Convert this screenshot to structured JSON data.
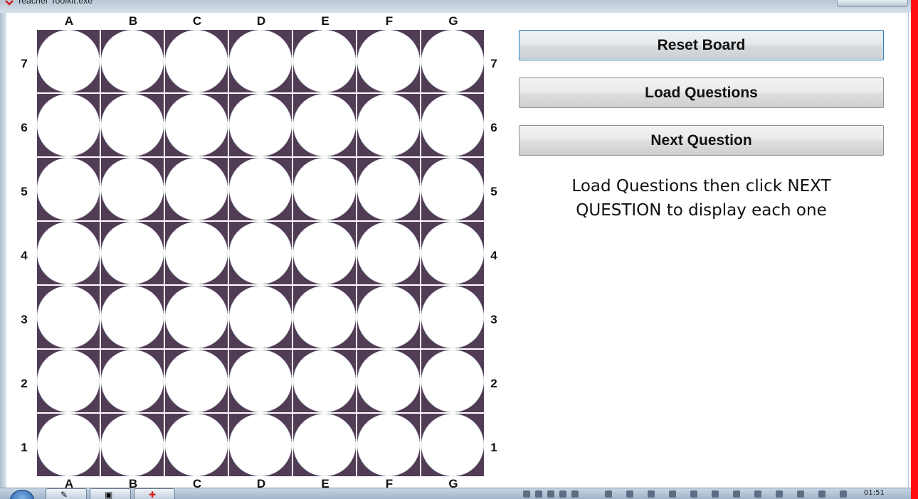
{
  "window": {
    "title": "Teacher Toolkit.exe"
  },
  "board": {
    "columns": [
      "A",
      "B",
      "C",
      "D",
      "E",
      "F",
      "G"
    ],
    "rows": [
      "7",
      "6",
      "5",
      "4",
      "3",
      "2",
      "1"
    ],
    "cell_color": "#513c56",
    "hole_color": "#ffffff"
  },
  "controls": {
    "reset_label": "Reset Board",
    "load_label": "Load Questions",
    "next_label": "Next Question"
  },
  "status": {
    "line1": "Load Questions then click NEXT",
    "line2": "QUESTION to display each one"
  },
  "taskbar": {
    "clock": "01:51"
  },
  "colors": {
    "accent_edge": "#ff0d0d"
  }
}
